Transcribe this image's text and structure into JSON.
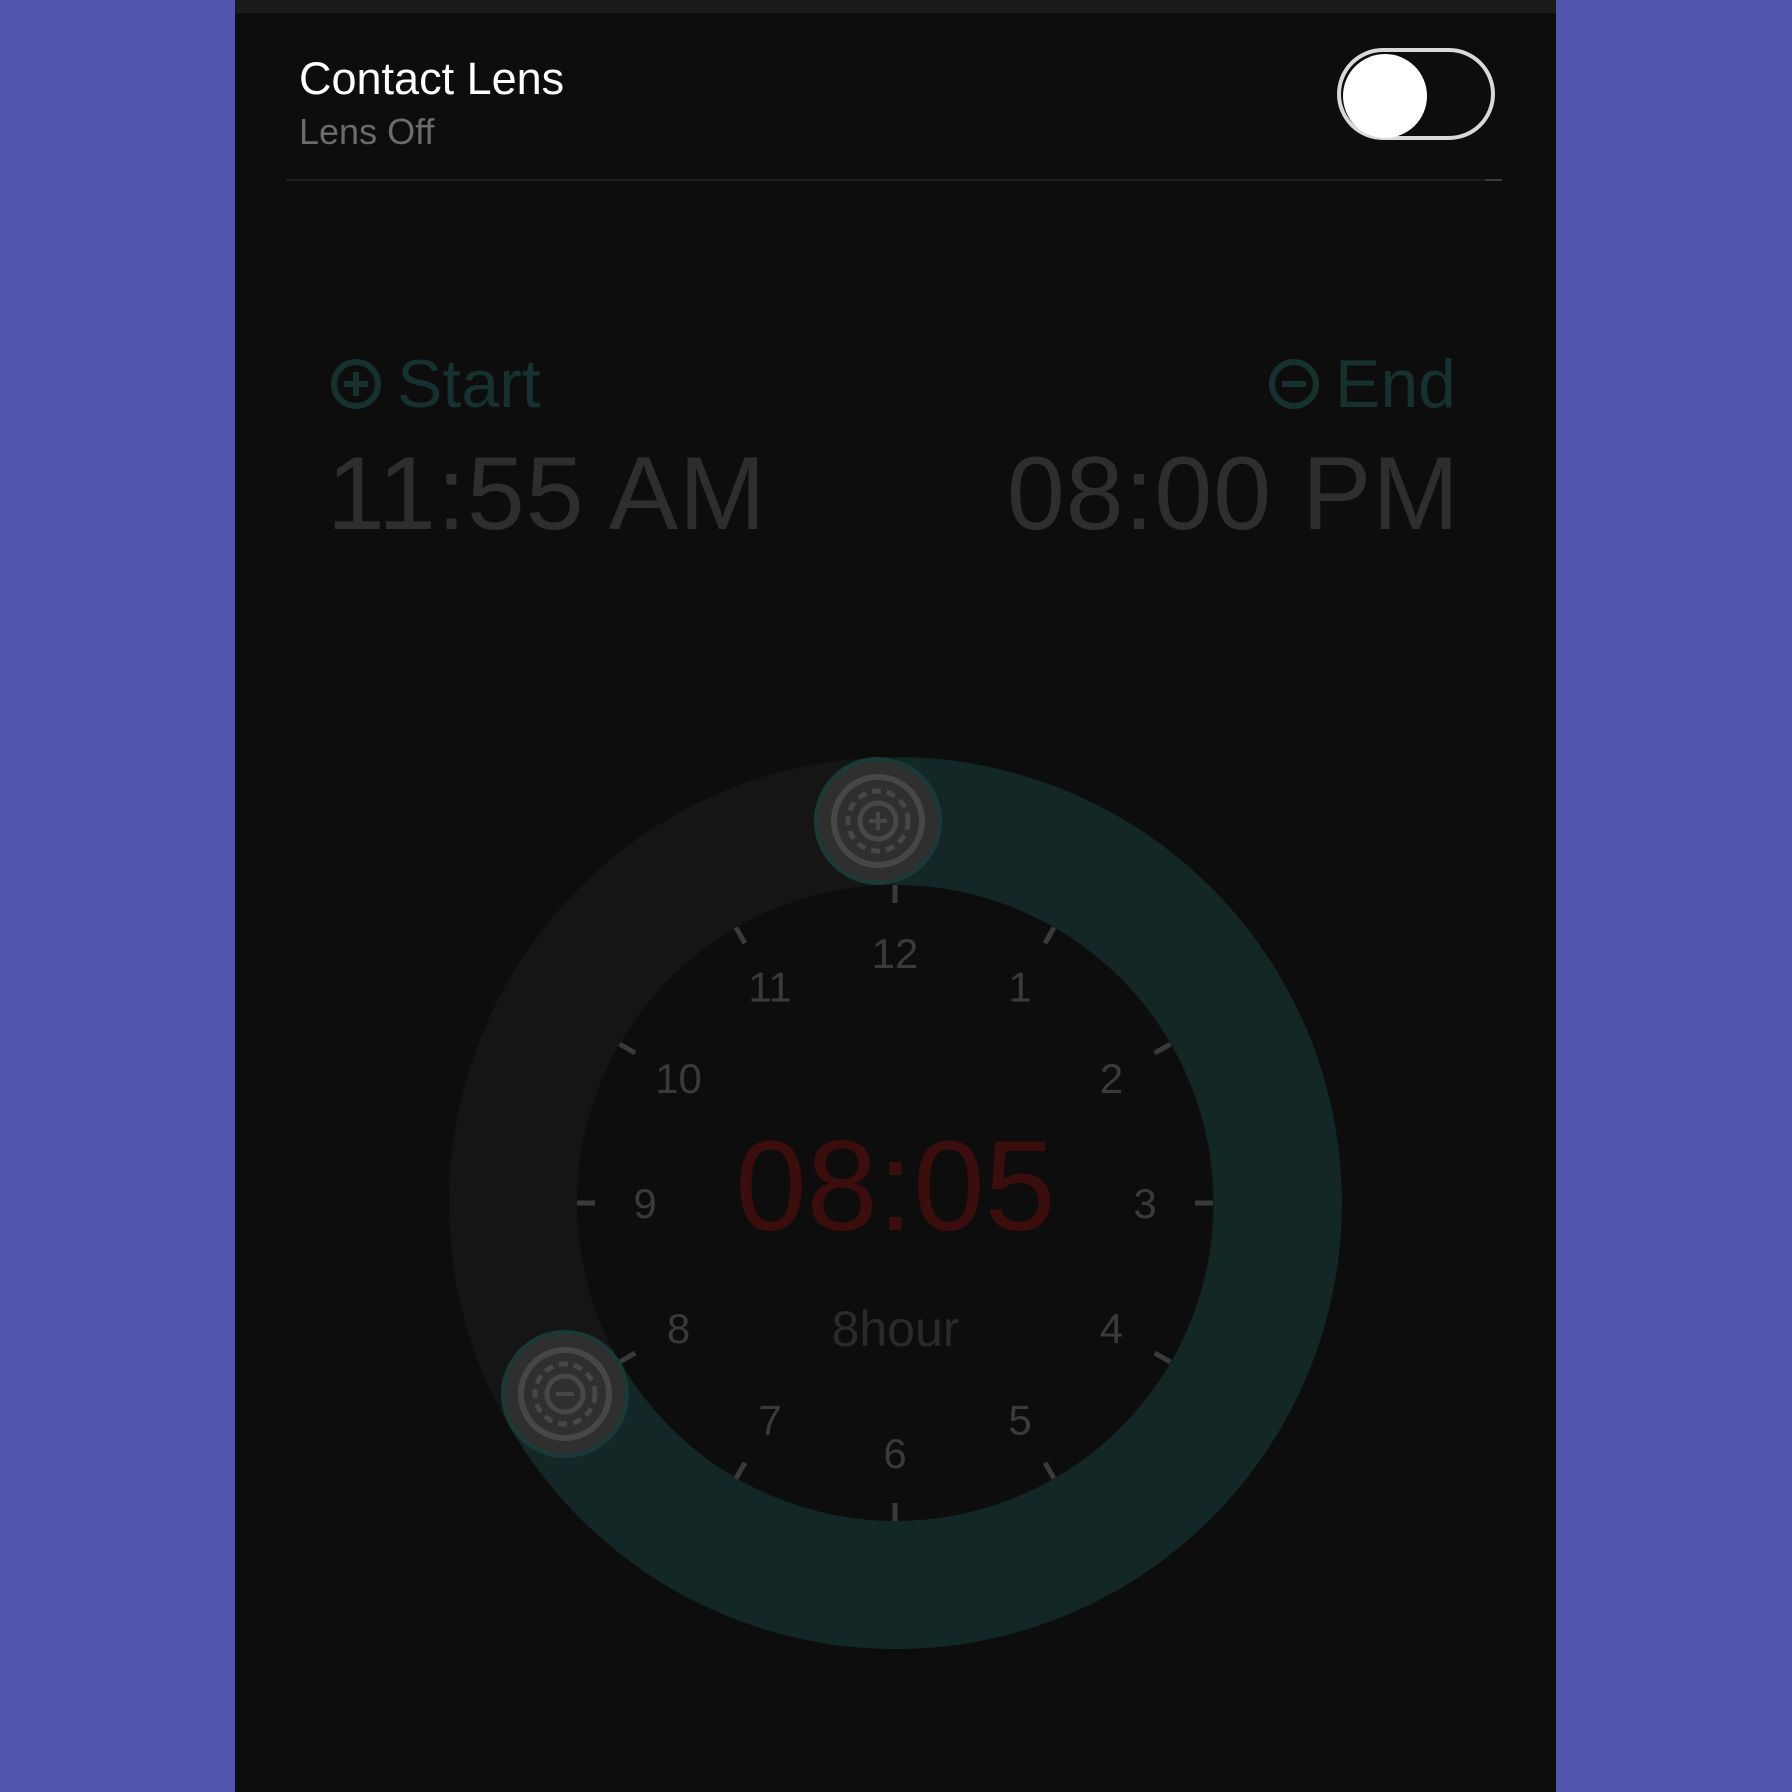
{
  "lens": {
    "title": "Contact Lens",
    "status": "Lens Off",
    "toggle_on": false
  },
  "schedule": {
    "start_label": "Start",
    "end_label": "End",
    "start_time": "11:55 AM",
    "end_time": "08:00 PM"
  },
  "dial": {
    "center_time": "08:05",
    "duration": "8hour",
    "hour_labels": [
      "12",
      "1",
      "2",
      "3",
      "4",
      "5",
      "6",
      "7",
      "8",
      "9",
      "10",
      "11"
    ],
    "start_handle_icon": "plus-lens-icon",
    "end_handle_icon": "minus-lens-icon"
  },
  "colors": {
    "background": "#5155b0",
    "panel": "#0d0d0d",
    "arc": "#132726",
    "track": "#151515",
    "accent_text": "#153130",
    "center_time": "#3b0d0d"
  }
}
